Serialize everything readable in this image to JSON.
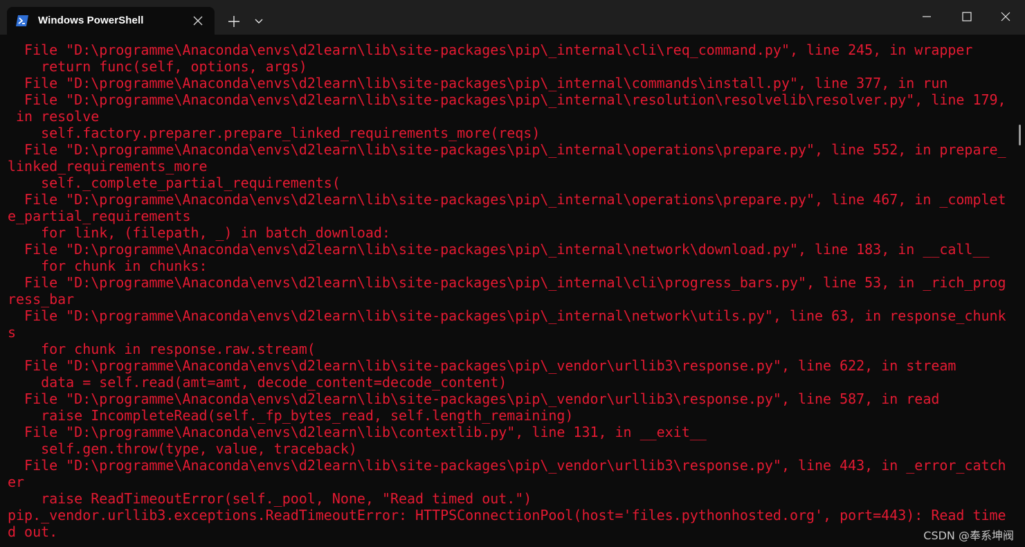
{
  "window": {
    "tab_title": "Windows PowerShell",
    "tab_close_icon": "close-icon",
    "new_tab_icon": "plus-icon",
    "dropdown_icon": "chevron-down-icon",
    "minimize_icon": "minimize-icon",
    "maximize_icon": "maximize-icon",
    "close_icon": "close-icon"
  },
  "colors": {
    "error_text": "#e41a32",
    "background": "#0c0c0c",
    "titlebar": "#1f1f1f"
  },
  "terminal": {
    "lines": [
      "  File \"D:\\programme\\Anaconda\\envs\\d2learn\\lib\\site-packages\\pip\\_internal\\cli\\req_command.py\", line 245, in wrapper",
      "    return func(self, options, args)",
      "  File \"D:\\programme\\Anaconda\\envs\\d2learn\\lib\\site-packages\\pip\\_internal\\commands\\install.py\", line 377, in run",
      "  File \"D:\\programme\\Anaconda\\envs\\d2learn\\lib\\site-packages\\pip\\_internal\\resolution\\resolvelib\\resolver.py\", line 179,",
      " in resolve",
      "    self.factory.preparer.prepare_linked_requirements_more(reqs)",
      "  File \"D:\\programme\\Anaconda\\envs\\d2learn\\lib\\site-packages\\pip\\_internal\\operations\\prepare.py\", line 552, in prepare_",
      "linked_requirements_more",
      "    self._complete_partial_requirements(",
      "  File \"D:\\programme\\Anaconda\\envs\\d2learn\\lib\\site-packages\\pip\\_internal\\operations\\prepare.py\", line 467, in _complet",
      "e_partial_requirements",
      "    for link, (filepath, _) in batch_download:",
      "  File \"D:\\programme\\Anaconda\\envs\\d2learn\\lib\\site-packages\\pip\\_internal\\network\\download.py\", line 183, in __call__",
      "    for chunk in chunks:",
      "  File \"D:\\programme\\Anaconda\\envs\\d2learn\\lib\\site-packages\\pip\\_internal\\cli\\progress_bars.py\", line 53, in _rich_prog",
      "ress_bar",
      "  File \"D:\\programme\\Anaconda\\envs\\d2learn\\lib\\site-packages\\pip\\_internal\\network\\utils.py\", line 63, in response_chunk",
      "s",
      "    for chunk in response.raw.stream(",
      "  File \"D:\\programme\\Anaconda\\envs\\d2learn\\lib\\site-packages\\pip\\_vendor\\urllib3\\response.py\", line 622, in stream",
      "    data = self.read(amt=amt, decode_content=decode_content)",
      "  File \"D:\\programme\\Anaconda\\envs\\d2learn\\lib\\site-packages\\pip\\_vendor\\urllib3\\response.py\", line 587, in read",
      "    raise IncompleteRead(self._fp_bytes_read, self.length_remaining)",
      "  File \"D:\\programme\\Anaconda\\envs\\d2learn\\lib\\contextlib.py\", line 131, in __exit__",
      "    self.gen.throw(type, value, traceback)",
      "  File \"D:\\programme\\Anaconda\\envs\\d2learn\\lib\\site-packages\\pip\\_vendor\\urllib3\\response.py\", line 443, in _error_catch",
      "er",
      "    raise ReadTimeoutError(self._pool, None, \"Read timed out.\")",
      "pip._vendor.urllib3.exceptions.ReadTimeoutError: HTTPSConnectionPool(host='files.pythonhosted.org', port=443): Read time",
      "d out."
    ]
  },
  "watermark": "CSDN @奉系坤阀"
}
